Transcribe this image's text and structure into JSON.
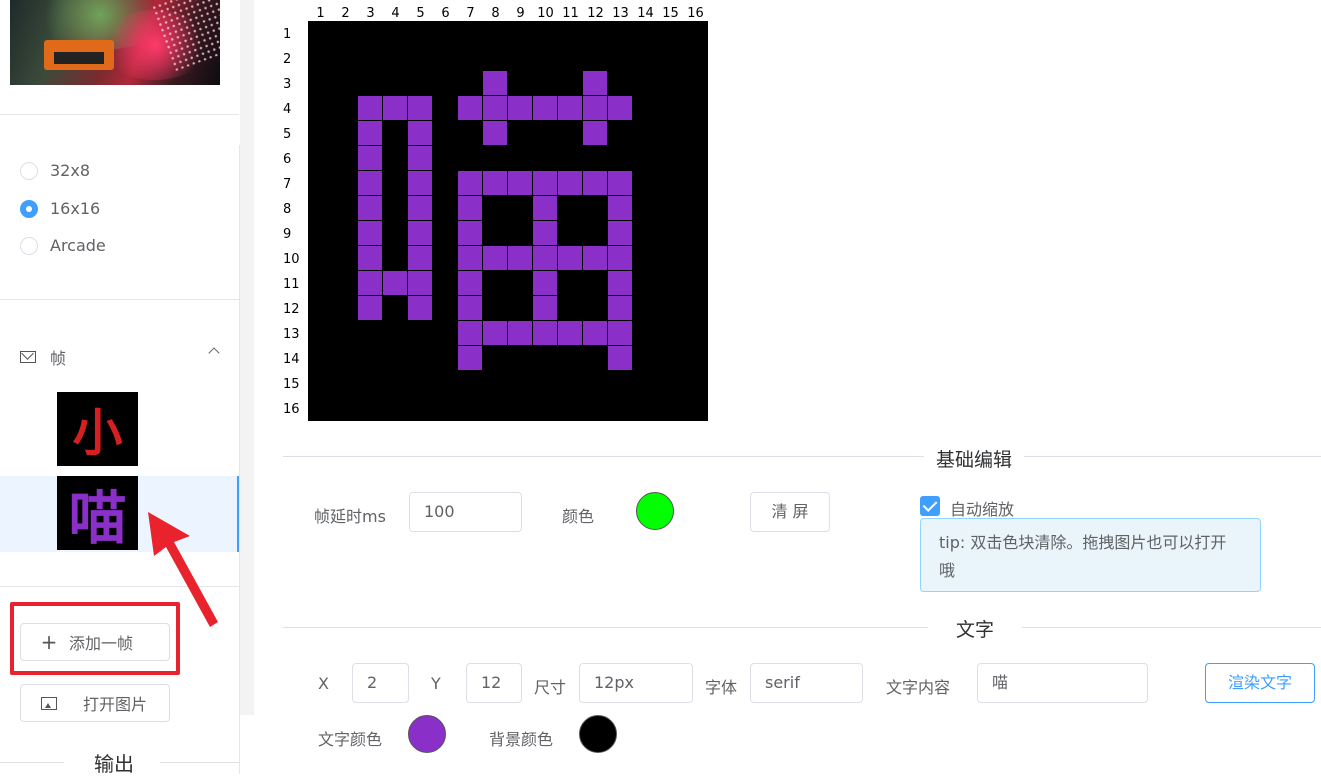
{
  "sidebar": {
    "sizes": [
      {
        "label": "32x8",
        "checked": false
      },
      {
        "label": "16x16",
        "checked": true
      },
      {
        "label": "Arcade",
        "checked": false
      }
    ],
    "frames_title": "帧",
    "frames": [
      {
        "char": "小",
        "color": "#d42020",
        "selected": false
      },
      {
        "char": "喵",
        "color": "#8b2fc9",
        "selected": true
      }
    ],
    "add_frame_label": "添加一帧",
    "open_image_label": "打开图片",
    "output_heading": "输出"
  },
  "grid": {
    "columns": [
      "1",
      "2",
      "3",
      "4",
      "5",
      "6",
      "7",
      "8",
      "9",
      "10",
      "11",
      "12",
      "13",
      "14",
      "15",
      "16"
    ],
    "rows": [
      "1",
      "2",
      "3",
      "4",
      "5",
      "6",
      "7",
      "8",
      "9",
      "10",
      "11",
      "12",
      "13",
      "14",
      "15",
      "16"
    ],
    "pixel_color": "#8b2fc9",
    "background": "#000000",
    "pixels": [
      [
        8,
        3
      ],
      [
        12,
        3
      ],
      [
        3,
        4
      ],
      [
        4,
        4
      ],
      [
        5,
        4
      ],
      [
        7,
        4
      ],
      [
        8,
        4
      ],
      [
        9,
        4
      ],
      [
        10,
        4
      ],
      [
        11,
        4
      ],
      [
        12,
        4
      ],
      [
        13,
        4
      ],
      [
        3,
        5
      ],
      [
        5,
        5
      ],
      [
        8,
        5
      ],
      [
        12,
        5
      ],
      [
        3,
        6
      ],
      [
        5,
        6
      ],
      [
        3,
        7
      ],
      [
        5,
        7
      ],
      [
        7,
        7
      ],
      [
        8,
        7
      ],
      [
        9,
        7
      ],
      [
        10,
        7
      ],
      [
        11,
        7
      ],
      [
        12,
        7
      ],
      [
        13,
        7
      ],
      [
        3,
        8
      ],
      [
        5,
        8
      ],
      [
        7,
        8
      ],
      [
        10,
        8
      ],
      [
        13,
        8
      ],
      [
        3,
        9
      ],
      [
        5,
        9
      ],
      [
        7,
        9
      ],
      [
        10,
        9
      ],
      [
        13,
        9
      ],
      [
        3,
        10
      ],
      [
        5,
        10
      ],
      [
        7,
        10
      ],
      [
        8,
        10
      ],
      [
        9,
        10
      ],
      [
        10,
        10
      ],
      [
        11,
        10
      ],
      [
        12,
        10
      ],
      [
        13,
        10
      ],
      [
        3,
        11
      ],
      [
        4,
        11
      ],
      [
        5,
        11
      ],
      [
        7,
        11
      ],
      [
        10,
        11
      ],
      [
        13,
        11
      ],
      [
        3,
        12
      ],
      [
        5,
        12
      ],
      [
        7,
        12
      ],
      [
        10,
        12
      ],
      [
        13,
        12
      ],
      [
        7,
        13
      ],
      [
        8,
        13
      ],
      [
        9,
        13
      ],
      [
        10,
        13
      ],
      [
        11,
        13
      ],
      [
        12,
        13
      ],
      [
        13,
        13
      ],
      [
        7,
        14
      ],
      [
        13,
        14
      ]
    ]
  },
  "basic_edit": {
    "title": "基础编辑",
    "delay_label": "帧延时ms",
    "delay_value": "100",
    "color_label": "颜色",
    "color_value": "#00ff00",
    "clear_label": "清 屏",
    "auto_zoom_label": "自动缩放",
    "auto_zoom_checked": true,
    "tip": "tip: 双击色块清除。拖拽图片也可以打开哦"
  },
  "text_section": {
    "title": "文字",
    "x_label": "X",
    "x_value": "2",
    "y_label": "Y",
    "y_value": "12",
    "size_label": "尺寸",
    "size_value": "12px",
    "font_label": "字体",
    "font_value": "serif",
    "content_label": "文字内容",
    "content_value": "喵",
    "render_label": "渲染文字",
    "text_color_label": "文字颜色",
    "text_color_value": "#8b2fc9",
    "bg_color_label": "背景颜色",
    "bg_color_value": "#000000"
  },
  "annotation_color": "#e8232d"
}
